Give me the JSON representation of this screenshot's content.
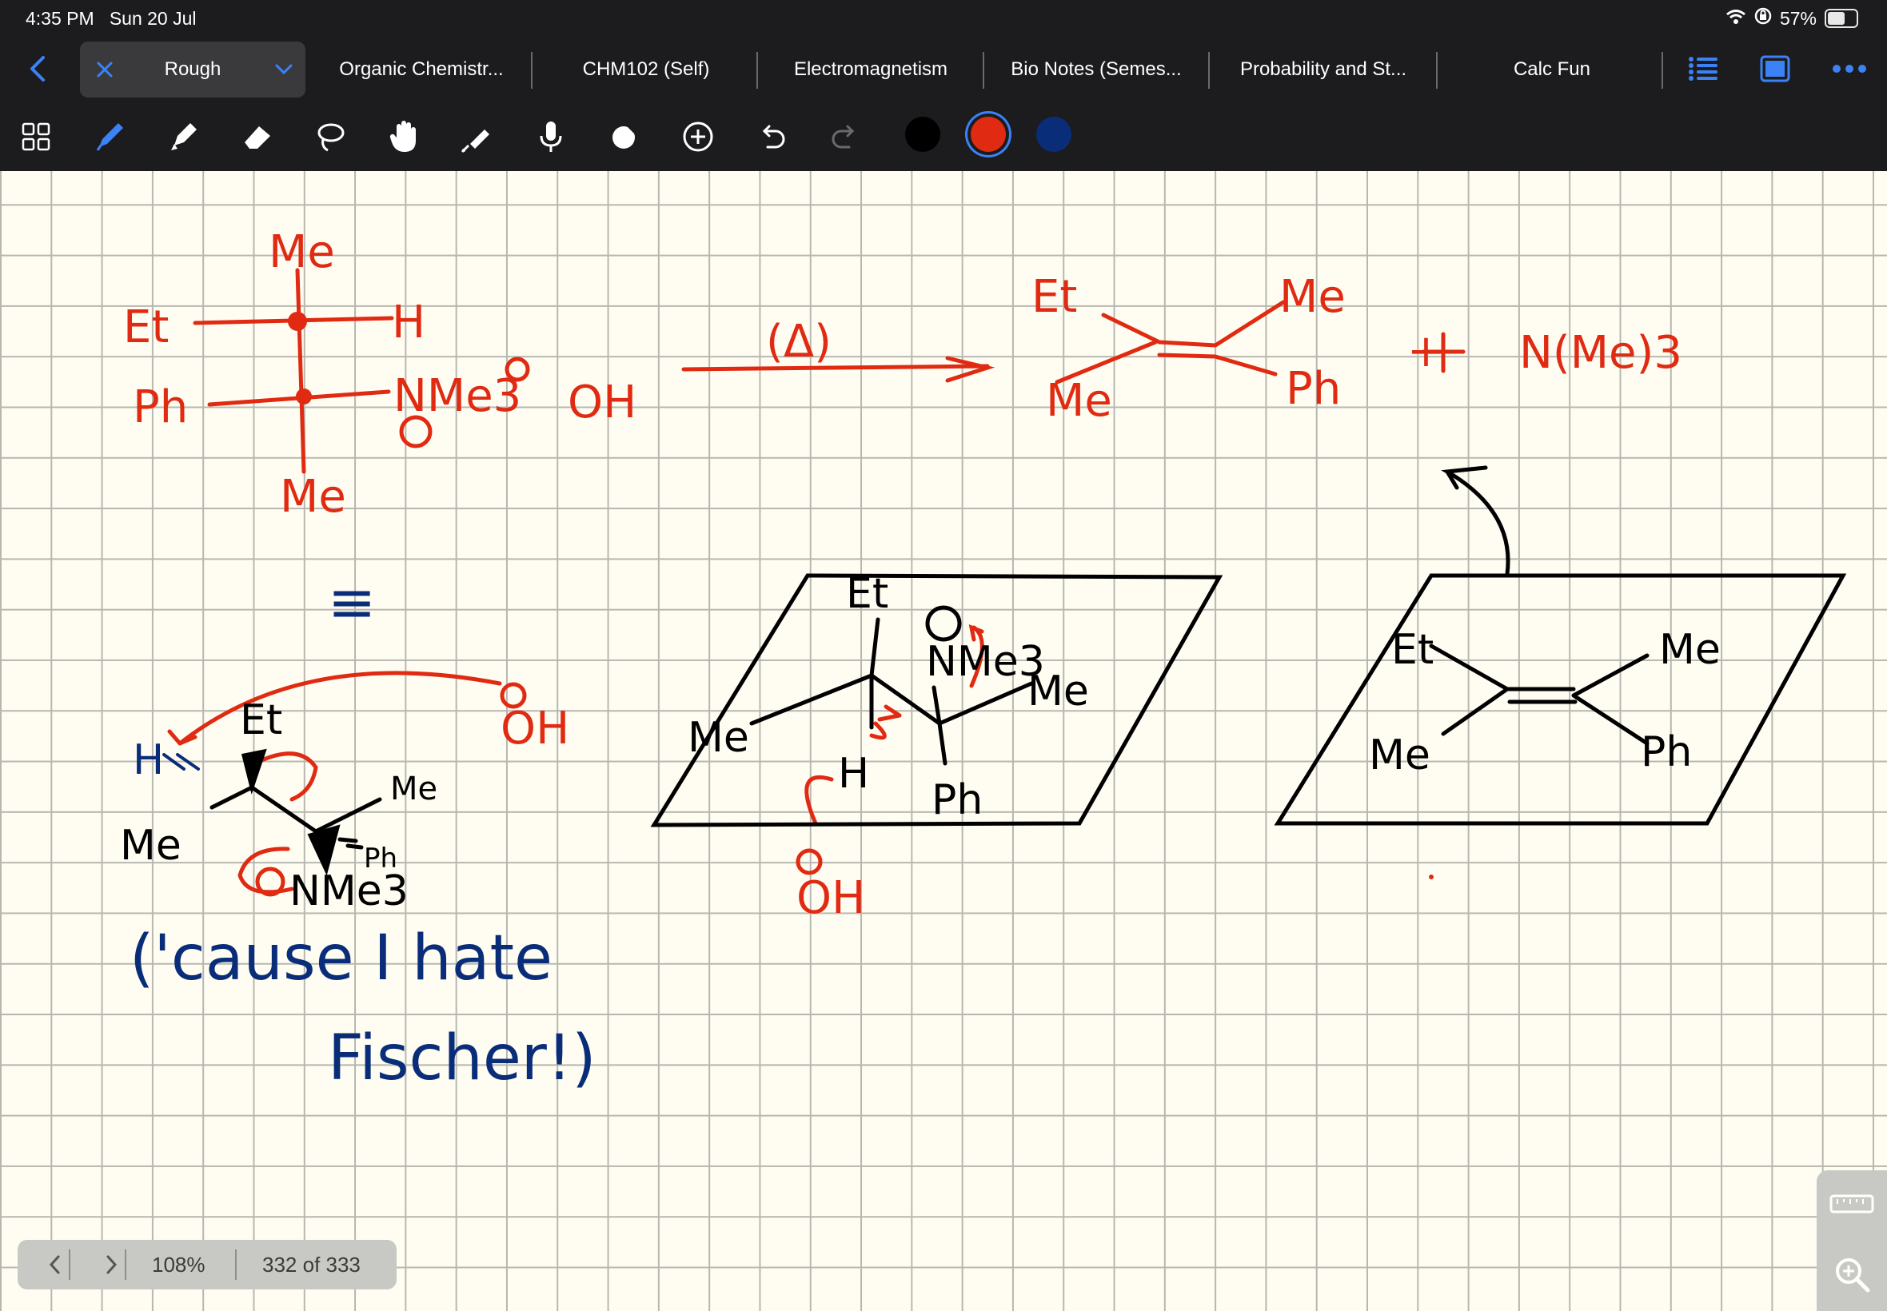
{
  "status_bar": {
    "time": "4:35 PM",
    "date": "Sun 20 Jul",
    "battery": "57%"
  },
  "tabs": [
    {
      "label": "Rough",
      "active": true
    },
    {
      "label": "Organic Chemistr..."
    },
    {
      "label": "CHM102 (Self)"
    },
    {
      "label": "Electromagnetism"
    },
    {
      "label": "Bio Notes (Semes..."
    },
    {
      "label": "Probability and St..."
    },
    {
      "label": "Calc Fun"
    }
  ],
  "toolbar": {
    "tools": [
      "grid-icon",
      "pen-icon",
      "highlighter-icon",
      "eraser-icon",
      "lasso-icon",
      "hand-icon",
      "laser-pointer-icon",
      "microphone-icon",
      "shapes-icon",
      "add-icon",
      "undo-icon",
      "redo-icon"
    ],
    "colors": [
      "#000000",
      "#e02a12",
      "#0a2d7a"
    ],
    "selected_color": "#e02a12"
  },
  "pager": {
    "zoom": "108%",
    "page": "332 of 333"
  },
  "note": {
    "red": [
      "Me",
      "Et",
      "H",
      "Ph",
      "NMe3",
      "OH",
      "Me",
      "(Δ)",
      "Et",
      "Me",
      "Me",
      "Ph",
      "+",
      "N(Me)3",
      "OH",
      "OH"
    ],
    "black": [
      "Et",
      "Me",
      "Me",
      "Ph",
      "NMe3",
      "Et",
      "NMe3",
      "Me",
      "Me",
      "H",
      "Ph",
      "Et",
      "Me",
      "Me",
      "Ph"
    ],
    "blue": [
      "H",
      "≡",
      "('cause I hate",
      "Fischer!)"
    ]
  }
}
